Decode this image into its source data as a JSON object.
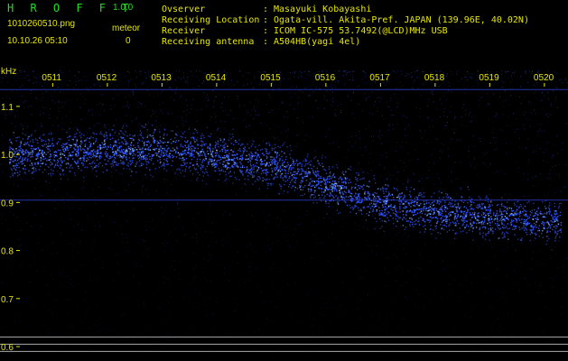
{
  "header": {
    "app_title": "H R O F F T",
    "version": "1.0.0",
    "filename": "1010260510.png",
    "datetime": "10.10.26 05:10",
    "meteor_label": "meteor",
    "meteor_count": "0",
    "info_rows": [
      {
        "label": "Ovserver",
        "value": "Masayuki Kobayashi"
      },
      {
        "label": "Receiving Location",
        "value": "Ogata-vill. Akita-Pref. JAPAN (139.96E, 40.02N)"
      },
      {
        "label": "Receiver",
        "value": "ICOM IC-575 53.7492(@LCD)MHz USB"
      },
      {
        "label": "Receiving antenna",
        "value": "A504HB(yagi 4el)"
      }
    ],
    "colon": ":"
  },
  "colors": {
    "background": "#000000",
    "title_green": "#22dd22",
    "text_yellow": "#e6e600",
    "signal_blue": "#3355ff",
    "reference_line": "#aaaaaa",
    "frequency_line": "#2233aa"
  },
  "chart_data": {
    "type": "heatmap",
    "y_unit": "kHz",
    "y_ticks": [
      "1.1",
      "1.0",
      "0.9",
      "0.8",
      "0.7",
      "0.6"
    ],
    "y_tick_values": [
      1.1,
      1.0,
      0.9,
      0.8,
      0.7,
      0.6
    ],
    "ylim": [
      0.57,
      1.19
    ],
    "x_ticks": [
      "0511",
      "0512",
      "0513",
      "0514",
      "0515",
      "0516",
      "0517",
      "0518",
      "0519",
      "0520"
    ],
    "x_tick_minutes": [
      1,
      2,
      3,
      4,
      5,
      6,
      7,
      8,
      9,
      10
    ],
    "xlim": [
      0.2,
      10.3
    ],
    "signal_trace": [
      {
        "t": 0.2,
        "f": 1.0
      },
      {
        "t": 1.0,
        "f": 1.0
      },
      {
        "t": 2.0,
        "f": 1.01
      },
      {
        "t": 3.0,
        "f": 1.01
      },
      {
        "t": 4.0,
        "f": 1.0
      },
      {
        "t": 5.0,
        "f": 0.98
      },
      {
        "t": 5.5,
        "f": 0.96
      },
      {
        "t": 6.0,
        "f": 0.94
      },
      {
        "t": 7.0,
        "f": 0.9
      },
      {
        "t": 8.0,
        "f": 0.88
      },
      {
        "t": 9.0,
        "f": 0.87
      },
      {
        "t": 10.3,
        "f": 0.86
      }
    ],
    "frequency_lines_khz": [
      1.135,
      0.905
    ],
    "reference_lines_khz": [
      0.62,
      0.605,
      0.59
    ]
  }
}
